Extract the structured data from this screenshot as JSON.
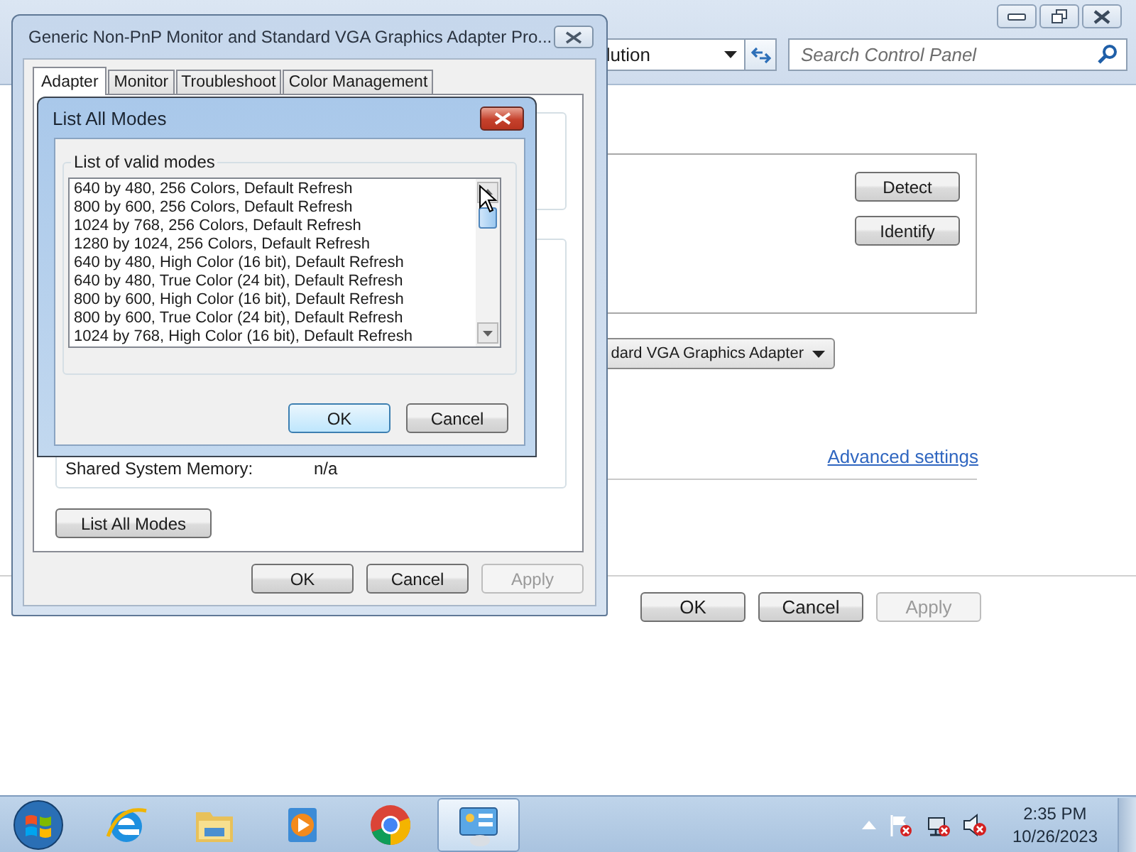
{
  "background_window": {
    "address_bar": {
      "text": "lution"
    },
    "search": {
      "placeholder": "Search Control Panel"
    },
    "display_buttons": [
      {
        "label": "Detect"
      },
      {
        "label": "Identify"
      }
    ],
    "adapter_dropdown": {
      "value": "dard VGA Graphics Adapter"
    },
    "advanced_link": "Advanced settings",
    "buttons": [
      {
        "label": "OK",
        "disabled": false
      },
      {
        "label": "Cancel",
        "disabled": false
      },
      {
        "label": "Apply",
        "disabled": true
      }
    ]
  },
  "properties_dialog": {
    "title": "Generic Non-PnP Monitor and Standard VGA Graphics Adapter Pro...",
    "tabs": [
      {
        "label": "Adapter",
        "selected": true
      },
      {
        "label": "Monitor",
        "selected": false
      },
      {
        "label": "Troubleshoot",
        "selected": false
      },
      {
        "label": "Color Management",
        "selected": false
      }
    ],
    "shared_memory": {
      "label": "Shared System Memory:",
      "value": "n/a"
    },
    "list_all_modes_button": "List All Modes",
    "buttons": [
      {
        "label": "OK",
        "disabled": false
      },
      {
        "label": "Cancel",
        "disabled": false
      },
      {
        "label": "Apply",
        "disabled": true
      }
    ]
  },
  "modes_dialog": {
    "title": "List All Modes",
    "group_label": "List of valid modes",
    "modes": [
      "640 by 480, 256 Colors, Default Refresh",
      "800 by 600, 256 Colors, Default Refresh",
      "1024 by 768, 256 Colors, Default Refresh",
      "1280 by 1024, 256 Colors, Default Refresh",
      "640 by 480, High Color (16 bit), Default Refresh",
      "640 by 480, True Color (24 bit), Default Refresh",
      "800 by 600, High Color (16 bit), Default Refresh",
      "800 by 600, True Color (24 bit), Default Refresh",
      "1024 by 768, High Color (16 bit), Default Refresh"
    ],
    "buttons": [
      {
        "label": "OK",
        "default": true
      },
      {
        "label": "Cancel",
        "default": false
      }
    ]
  },
  "taskbar": {
    "apps": [
      {
        "kind": "browser-e",
        "active": false
      },
      {
        "kind": "folder",
        "active": false
      },
      {
        "kind": "media",
        "active": false
      },
      {
        "kind": "chrome",
        "active": false
      },
      {
        "kind": "control-panel",
        "active": true
      }
    ],
    "clock": {
      "time": "2:35 PM",
      "date": "10/26/2023"
    }
  }
}
